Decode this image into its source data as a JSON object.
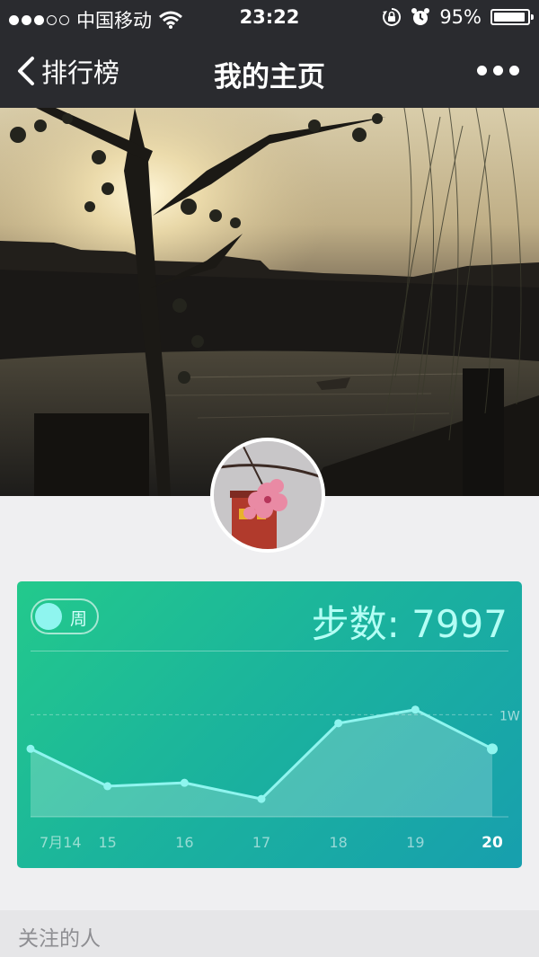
{
  "status_bar": {
    "carrier": "中国移动",
    "time": "23:22",
    "battery": "95%",
    "battery_level": 0.95,
    "signal_bars_filled": 3,
    "signal_bars_total": 5
  },
  "nav": {
    "back_label": "排行榜",
    "title": "我的主页"
  },
  "stats_card": {
    "toggle_label": "周",
    "steps_text": "步数: 7997",
    "colors": {
      "start": "#23c98c",
      "end": "#179fae",
      "line": "#8ff5ef"
    }
  },
  "chart_data": {
    "type": "line",
    "categories": [
      "7月14",
      "15",
      "16",
      "17",
      "18",
      "19",
      "20"
    ],
    "series": [
      {
        "values": [
          8000,
          5800,
          6000,
          5050,
          9500,
          10300,
          7997
        ]
      }
    ],
    "reference_line": {
      "value": 10000,
      "label": "1W"
    },
    "ylim": [
      4000,
      11500
    ],
    "highlight_category": "20"
  },
  "follow_section": {
    "title": "关注的人"
  }
}
